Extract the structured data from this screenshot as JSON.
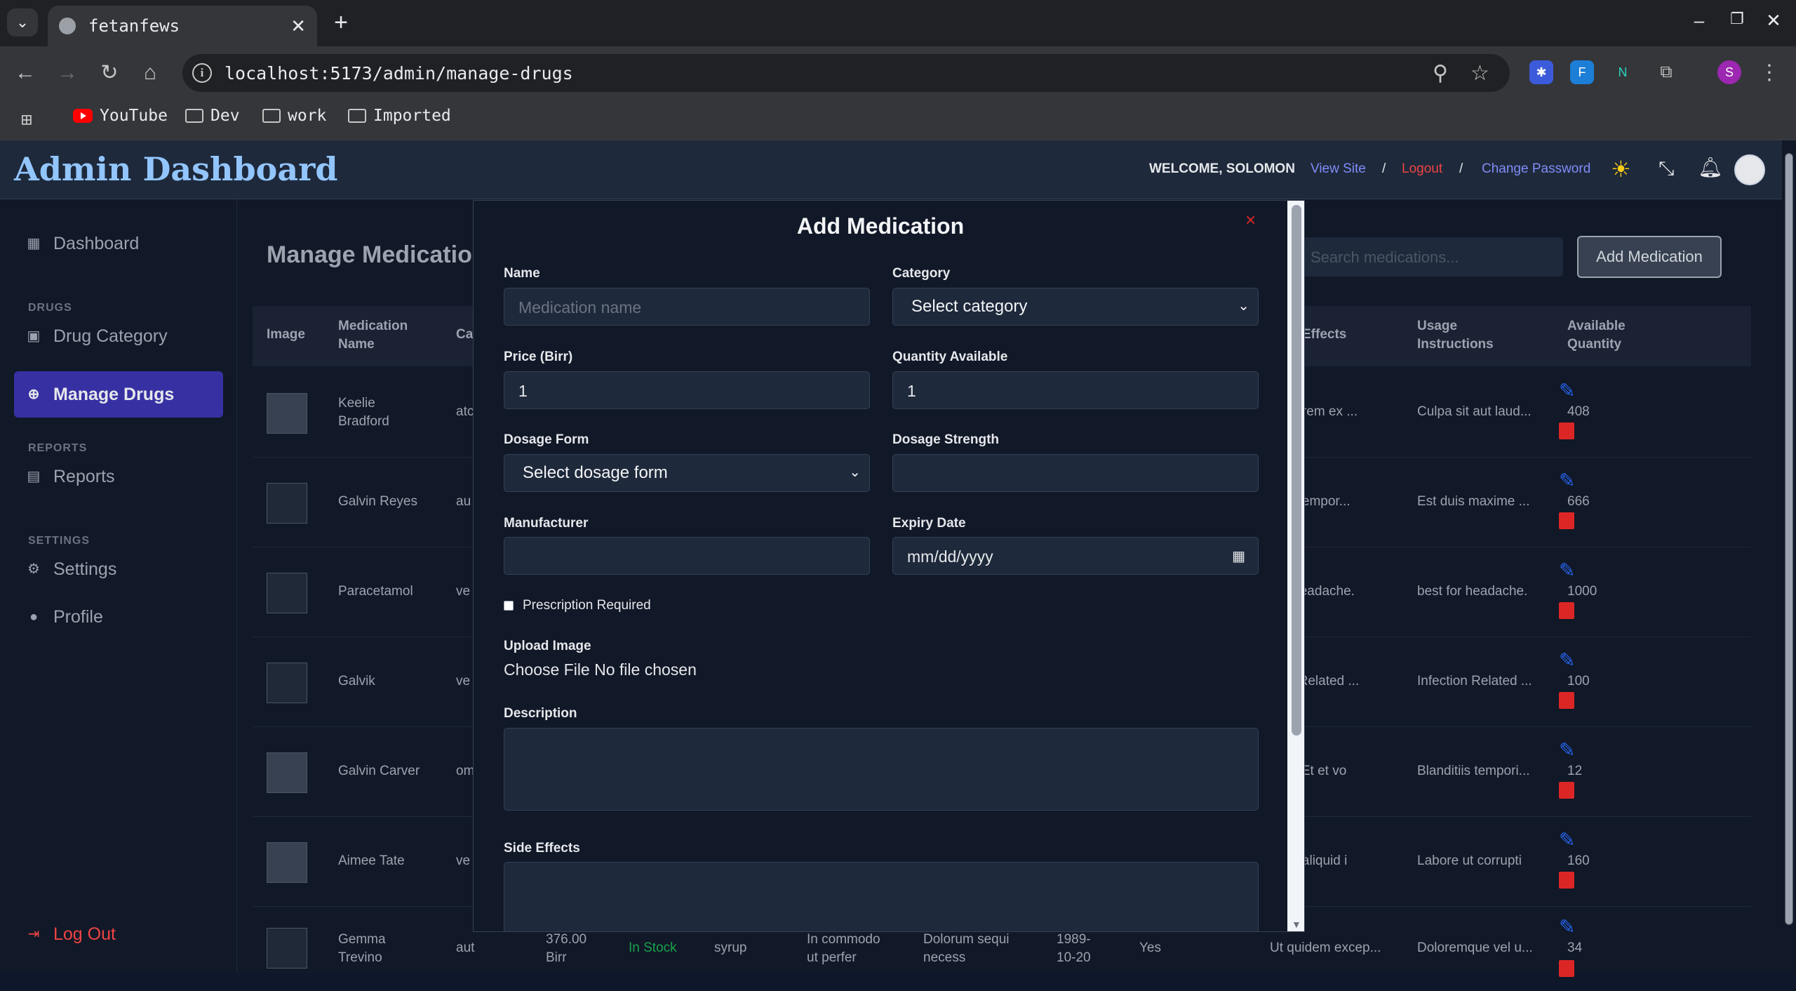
{
  "browser": {
    "tab_title": "fetanfews",
    "url": "localhost:5173/admin/manage-drugs",
    "bookmarks": [
      "YouTube",
      "Dev",
      "work",
      "Imported"
    ],
    "profile_initial": "S"
  },
  "header": {
    "brand": "Admin Dashboard",
    "welcome": "WELCOME, SOLOMON",
    "view_site": "View Site",
    "sep": "/",
    "logout": "Logout",
    "change_password": "Change Password"
  },
  "sidebar": {
    "dashboard": "Dashboard",
    "sec_drugs": "DRUGS",
    "drug_category": "Drug Category",
    "manage_drugs": "Manage Drugs",
    "sec_reports": "REPORTS",
    "reports": "Reports",
    "sec_settings": "SETTINGS",
    "settings": "Settings",
    "profile": "Profile",
    "logout": "Log Out"
  },
  "main": {
    "title": "Manage Medications",
    "search_placeholder": "Search medications...",
    "add_button": "Add Medication",
    "columns": {
      "image": "Image",
      "name_1": "Medication",
      "name_2": "Name",
      "category": "Ca",
      "effects": "Effects",
      "usage_1": "Usage",
      "usage_2": "Instructions",
      "avail_1": "Available",
      "avail_2": "Quantity"
    },
    "rows": [
      {
        "name_1": "Keelie",
        "name_2": "Bradford",
        "cat": "atc",
        "effects": "dolorem ex ...",
        "usage": "Culpa sit aut laud...",
        "qty": "408"
      },
      {
        "name_1": "Galvin Reyes",
        "name_2": "",
        "cat": "au",
        "effects": "est tempor...",
        "usage": "Est duis maxime ...",
        "qty": "666"
      },
      {
        "name_1": "Paracetamol",
        "name_2": "",
        "cat": "ve",
        "effects": "or headache.",
        "usage": "best for headache.",
        "qty": "1000"
      },
      {
        "name_1": "Galvik",
        "name_2": "",
        "cat": "ve",
        "effects": "ion Related ...",
        "usage": "Infection Related ...",
        "qty": "100"
      },
      {
        "name_1": "Galvin Carver",
        "name_2": "",
        "cat": "om",
        "effects": "ctio Et et vo",
        "usage": "Blanditiis tempori...",
        "qty": "12"
      },
      {
        "name_1": "Aimee Tate",
        "name_2": "",
        "cat": "ve",
        "effects": "giat aliquid i",
        "usage": "Labore ut corrupti",
        "qty": "160"
      }
    ],
    "last_row": {
      "name_1": "Gemma",
      "name_2": "Trevino",
      "cat": "aut",
      "price_1": "376.00",
      "price_2": "Birr",
      "status": "In Stock",
      "form": "syrup",
      "desc_1": "In commodo",
      "desc_2": "ut perfer",
      "side_1": "Dolorum sequi",
      "side_2": "necess",
      "exp_1": "1989-",
      "exp_2": "10-20",
      "presc": "Yes",
      "effects": "Ut quidem excep...",
      "usage": "Doloremque vel u...",
      "qty": "34"
    }
  },
  "modal": {
    "title": "Add Medication",
    "close": "×",
    "name_label": "Name",
    "name_placeholder": "Medication name",
    "category_label": "Category",
    "category_value": "Select category",
    "price_label": "Price (Birr)",
    "price_value": "1",
    "qty_label": "Quantity Available",
    "qty_value": "1",
    "form_label": "Dosage Form",
    "form_value": "Select dosage form",
    "strength_label": "Dosage Strength",
    "manufacturer_label": "Manufacturer",
    "expiry_label": "Expiry Date",
    "expiry_value": "mm/dd/yyyy",
    "prescription_label": "Prescription Required",
    "upload_label": "Upload Image",
    "upload_value": "Choose File No file chosen",
    "description_label": "Description",
    "side_effects_label": "Side Effects"
  },
  "colors": {
    "accent": "#3730a3",
    "logout": "#ef4444",
    "link": "#818cf8",
    "in_stock": "#16a34a"
  }
}
